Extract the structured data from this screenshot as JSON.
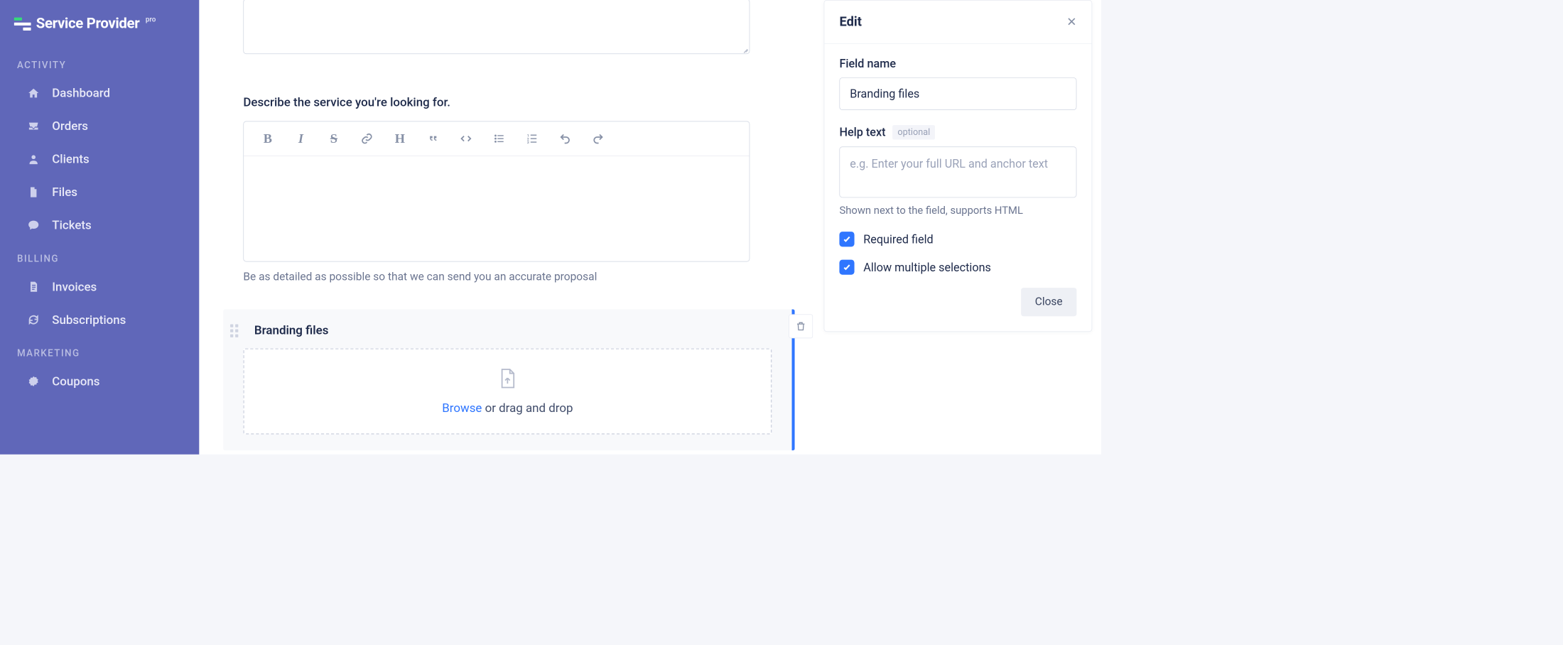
{
  "logo": {
    "text": "Service Provider",
    "pro": "pro"
  },
  "sidebar": {
    "sections": [
      {
        "label": "ACTIVITY",
        "items": [
          {
            "label": "Dashboard",
            "icon": "home-icon"
          },
          {
            "label": "Orders",
            "icon": "inbox-icon"
          },
          {
            "label": "Clients",
            "icon": "user-icon"
          },
          {
            "label": "Files",
            "icon": "file-icon"
          },
          {
            "label": "Tickets",
            "icon": "chat-icon"
          }
        ]
      },
      {
        "label": "BILLING",
        "items": [
          {
            "label": "Invoices",
            "icon": "invoice-icon"
          },
          {
            "label": "Subscriptions",
            "icon": "refresh-icon"
          }
        ]
      },
      {
        "label": "MARKETING",
        "items": [
          {
            "label": "Coupons",
            "icon": "badge-icon"
          }
        ]
      }
    ]
  },
  "form": {
    "describe_label": "Describe the service you're looking for.",
    "describe_help": "Be as detailed as possible so that we can send you an accurate proposal",
    "branding_card_title": "Branding files",
    "dropzone_browse": "Browse",
    "dropzone_rest": " or drag and drop"
  },
  "edit_panel": {
    "title": "Edit",
    "field_name_label": "Field name",
    "field_name_value": "Branding files",
    "help_label": "Help text",
    "help_optional": "optional",
    "help_placeholder": "e.g. Enter your full URL and anchor text",
    "help_sub": "Shown next to the field, supports HTML",
    "required_label": "Required field",
    "multiple_label": "Allow multiple selections",
    "close_label": "Close"
  }
}
